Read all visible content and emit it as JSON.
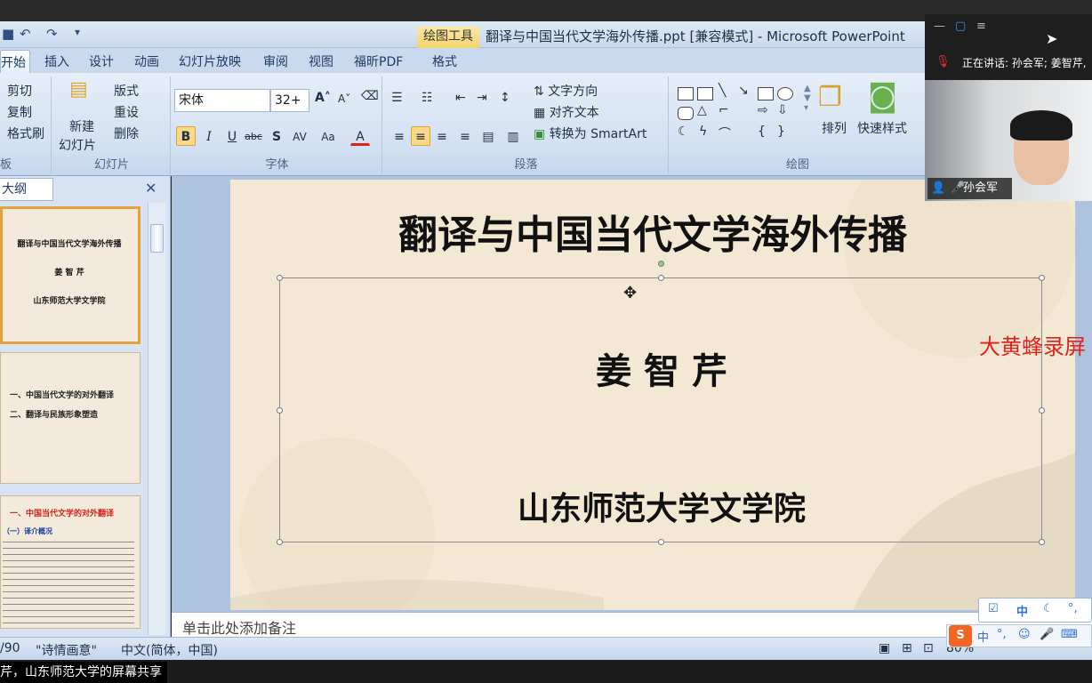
{
  "window": {
    "title": "翻译与中国当代文学海外传播.ppt [兼容模式] - Microsoft PowerPoint",
    "context_tool": "绘图工具"
  },
  "tabs": [
    "开始",
    "插入",
    "设计",
    "动画",
    "幻灯片放映",
    "审阅",
    "视图",
    "福昕PDF",
    "格式"
  ],
  "ribbon": {
    "clipboard": {
      "cut": "剪切",
      "copy": "复制",
      "format_painter": "格式刷",
      "label": "板"
    },
    "slides": {
      "new_slide": "新建",
      "new_slide2": "幻灯片",
      "layout": "版式",
      "reset": "重设",
      "delete": "删除",
      "label": "幻灯片"
    },
    "font": {
      "name": "宋体",
      "size": "32+",
      "label": "字体"
    },
    "paragraph": {
      "text_direction": "文字方向",
      "align_text": "对齐文本",
      "smartart": "转换为 SmartArt",
      "label": "段落"
    },
    "drawing": {
      "arrange": "排列",
      "quick_styles": "快速样式",
      "label": "绘图"
    }
  },
  "outline": {
    "tab": "大纲",
    "slide1": {
      "title": "翻译与中国当代文学海外传播",
      "author": "姜 智 芹",
      "org": "山东师范大学文学院"
    },
    "slide2": {
      "items": [
        "一、中国当代文学的对外翻译",
        "二、翻译与民族形象塑造"
      ]
    },
    "slide3": {
      "title": "一、中国当代文学的对外翻译",
      "sub": "（一）译介概况"
    }
  },
  "slide": {
    "title": "翻译与中国当代文学海外传播",
    "author": "姜 智 芹",
    "institution": "山东师范大学文学院"
  },
  "watermark": "大黄蜂录屏",
  "notes_placeholder": "单击此处添加备注",
  "status": {
    "slide_count": "/90",
    "theme": "\"诗情画意\"",
    "language": "中文(简体，中国)",
    "zoom": "80%"
  },
  "share_bar": "芹，山东师范大学的屏幕共享",
  "meeting": {
    "speaking": "正在讲话: 孙会军; 姜智芹,",
    "name": "孙会军"
  },
  "ime": {
    "mode": "中"
  }
}
